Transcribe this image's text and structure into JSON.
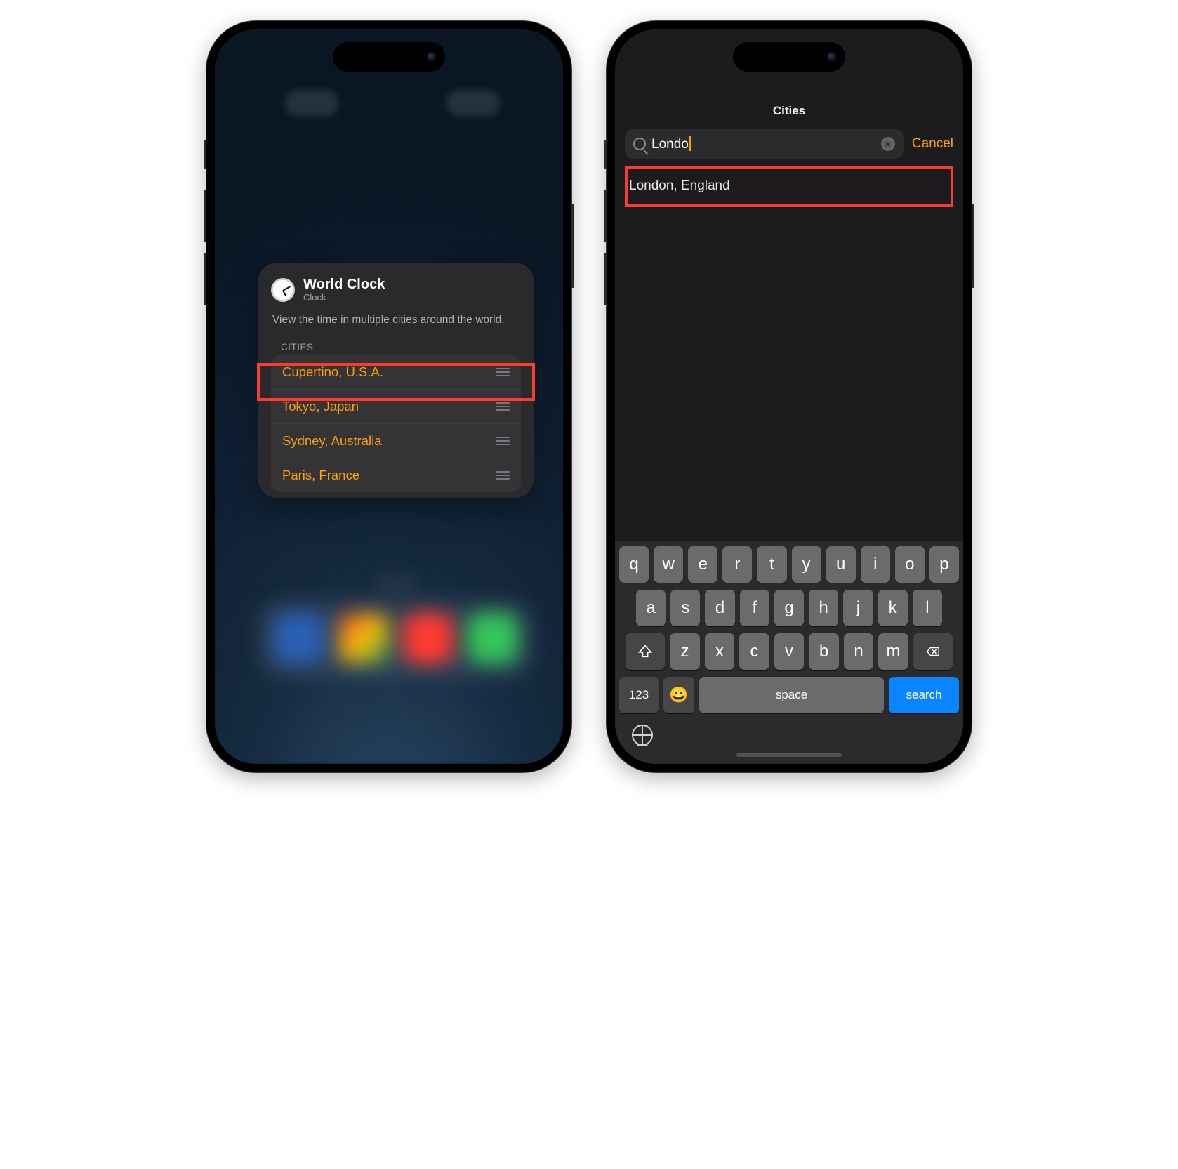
{
  "left": {
    "widget": {
      "title": "World Clock",
      "subtitle": "Clock",
      "description": "View the time in multiple cities around the world.",
      "section_header": "CITIES",
      "cities": [
        "Cupertino, U.S.A.",
        "Tokyo, Japan",
        "Sydney, Australia",
        "Paris, France"
      ]
    }
  },
  "right": {
    "nav_title": "Cities",
    "search": {
      "value": "Londo",
      "clear_icon_label": "×"
    },
    "cancel_label": "Cancel",
    "results": [
      "London, England"
    ],
    "keyboard": {
      "row1": [
        "q",
        "w",
        "e",
        "r",
        "t",
        "y",
        "u",
        "i",
        "o",
        "p"
      ],
      "row2": [
        "a",
        "s",
        "d",
        "f",
        "g",
        "h",
        "j",
        "k",
        "l"
      ],
      "row3": [
        "z",
        "x",
        "c",
        "v",
        "b",
        "n",
        "m"
      ],
      "numkey": "123",
      "emoji": "😀",
      "space": "space",
      "action": "search"
    }
  }
}
